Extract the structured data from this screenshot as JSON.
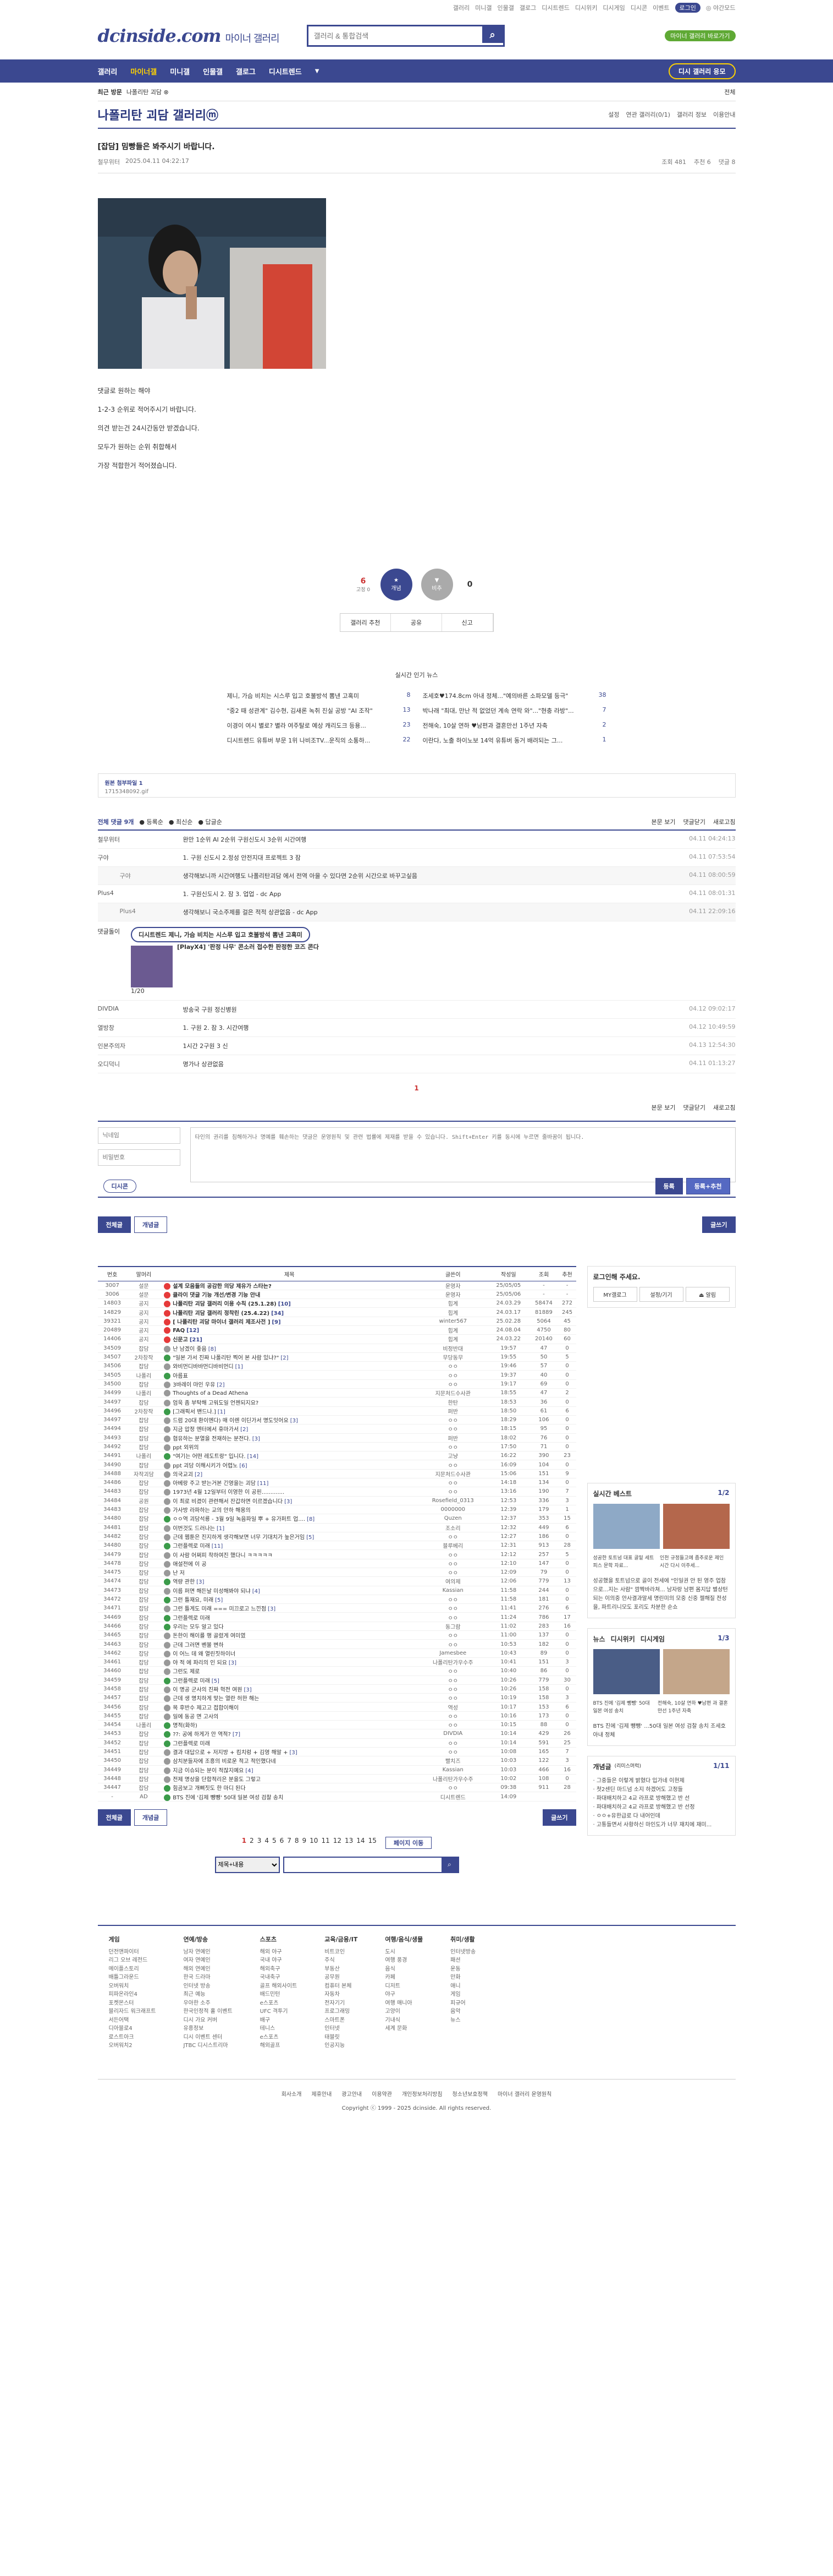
{
  "top_links": [
    "갤러리",
    "미니갤",
    "인물갤",
    "갤로그",
    "디시트렌드",
    "디시위키",
    "디시게임",
    "디시콘",
    "이벤트",
    "로그인",
    "◎ 야간모드"
  ],
  "top_pill": "로그인",
  "logo": "dcinside.com",
  "logo_sub": "마이너 갤러리",
  "search_placeholder": "갤러리 & 통합검색",
  "header_right": {
    "green": "마이너 갤러리 바로가기"
  },
  "gnb": {
    "items": [
      "갤러리",
      "마이너갤",
      "미니갤",
      "인물갤",
      "갤로그",
      "디시트렌드"
    ],
    "active": "마이너갤",
    "apply": "디시 갤러리 응모"
  },
  "subbar": {
    "left": "최근 방문",
    "chip": "나폴리탄 괴담 ⊗",
    "right": "전체"
  },
  "gallery": {
    "title": "나폴리탄 괴담 갤러리ⓜ",
    "tools": [
      "설정",
      "연관 갤러리(0/1)",
      "갤러리 정보",
      "이용안내"
    ]
  },
  "post": {
    "title": "[잡담] 밈빵들은 봐주시기 바랍니다.",
    "author": "철무위터",
    "date": "2025.04.11 04:22:17",
    "views": "조회 481",
    "recommend": "추천 6",
    "comments": "댓글 8",
    "body": [
      "댓글로 원하는 해야",
      "1-2-3 순위로 적어주시기 바랍니다.",
      "의견 받는건 24시간동안 받겠습니다.",
      "모두가 원하는 순위 취합해서",
      "가장 적합한거 적어졌습니다."
    ]
  },
  "vote": {
    "up": "6",
    "up_sub": "고정 0",
    "up_label": "개념",
    "down": "0",
    "down_label": "비추",
    "tools": [
      "갤러리 추천",
      "공유",
      "신고"
    ]
  },
  "hot": {
    "title": "실시간 인기 뉴스",
    "items": [
      {
        "t": "제니, 가슴 비치는 시스루 입고 호불방석 뽐낸 고혹미",
        "c": "8"
      },
      {
        "t": "조세호♥174.8cm 아내 정체...\"예의바른 소파모델 등극\"",
        "c": "38"
      },
      {
        "t": "\"중2 때 성관계\" 김수현, 김새론 녹취 진실 공방 \"AI 조작\"",
        "c": "13"
      },
      {
        "t": "박나래 \"최대, 만난 적 없었던 계속 연락 와\"...\"현충 라방\"...",
        "c": "7"
      },
      {
        "t": "이경이 여시 별로? 별라 여주탈로 예상 캐리도크 등용...",
        "c": "23"
      },
      {
        "t": "전해숙, 10살 연하 ♥남편과 결혼만선 1주년 자축",
        "c": "2"
      },
      {
        "t": "디시트렌드 유튜버 부문 1위 나비조TV...운직의 소통하...",
        "c": "22"
      },
      {
        "t": "이란다, 노출 하이노보 14억 유튜버 동거 배려되는 그...",
        "c": "1"
      }
    ]
  },
  "attach": {
    "label": "원본 첨부파일 1",
    "file": "1715348092.gif"
  },
  "cmt_bar": {
    "total": "전체 댓글 9개",
    "sort": [
      "등록순",
      "최신순",
      "답글순"
    ],
    "right": [
      "본문 보기",
      "댓글닫기",
      "새로고침"
    ]
  },
  "comments": [
    {
      "type": "c",
      "n": "철무위터",
      "t": "완만 1순위 AI 2순위 구원신도시 3순위 시간여행",
      "d": "04.11 04:24:13"
    },
    {
      "type": "c",
      "n": "구야",
      "t": "1. 구원 신도시 2.정성 안전지대 프로젝트 3 잠",
      "d": "04.11 07:53:54"
    },
    {
      "type": "r",
      "n": "구야",
      "t": "생각해보니까 시간여행도 나폴리탄괴담 에서 전역 아을 수 있다면 2순위 시간으로 바꾸고싶음",
      "d": "04.11 08:00:59"
    },
    {
      "type": "c",
      "n": "Plus4",
      "t": "1. 구원신도시 2. 잠 3. 업업 - dc App",
      "d": "04.11 08:01:31"
    },
    {
      "type": "r",
      "n": "Plus4",
      "t": "생각해보니 국소주제를 걸은 적적 상관없음 - dc App",
      "d": "04.11 22:09:16"
    },
    {
      "type": "c",
      "n": "DIVDIA",
      "t": "방송국 구원 정신병원",
      "d": "04.12 09:02:17"
    },
    {
      "type": "c",
      "n": "열방창",
      "t": "1. 구원  2. 잠  3. 시간여행",
      "d": "04.12 10:49:59"
    },
    {
      "type": "c",
      "n": "인본주의자",
      "t": "1시간 2구원 3 신",
      "d": "04.13 12:54:30"
    },
    {
      "type": "c",
      "n": "오디덕니",
      "t": "명가나 상관없음",
      "d": "04.11 01:13:27"
    }
  ],
  "ad": {
    "label": "댓글돌이",
    "bubble": "디시트렌드 제니, 가슴 비치는 시스루 입고 호불방석 뽐낸 고혹미",
    "title": "[PlayX4] '판정 나무' 콘소러 접수한 판정한 코즈 콘다",
    "page": "1/20"
  },
  "cmt_page": "1",
  "write": {
    "name_ph": "닉네임",
    "pw_ph": "비밀번호",
    "body_ph": "타인의 권리를 침해하거나 명예를 훼손하는 댓글은 운영원칙 및 관련 법률에 제재를 받을 수 있습니다. Shift+Enter 키를 동시에 누르면 줄바꿈이 됩니다.",
    "dccon": "디시콘",
    "submit": "등록",
    "submit2": "등록+추천"
  },
  "list_btns": {
    "all": "전체글",
    "concept": "개념글",
    "write": "글쓰기"
  },
  "table_head": [
    "번호",
    "말머리",
    "제목",
    "글쓴이",
    "작성일",
    "조회",
    "추천"
  ],
  "rows": [
    [
      "3007",
      "설문",
      "설계 모음들의 공감한 의당 제유가 스타는?",
      "운영자",
      "25/05/05",
      "-",
      "-",
      "n",
      ""
    ],
    [
      "3006",
      "설문",
      "클라이 댓글 기능 개선/변경 기능 안내",
      "운영자",
      "25/05/06",
      "-",
      "-",
      "n",
      ""
    ],
    [
      "14803",
      "공지",
      "나폴리탄 괴담 갤러리 이용 수칙 (25.1.28)",
      "힙계",
      "24.03.29",
      "58474",
      "272",
      "n",
      "10"
    ],
    [
      "14829",
      "공지",
      "나폴리탄 괴담 갤러리 정착린 (25.4.22)",
      "힙계",
      "24.03.17",
      "81889",
      "245",
      "n",
      "34"
    ],
    [
      "39321",
      "공지",
      "[ 나폴리탄 괴담 마이너 갤러리 제조사전 ]",
      "winter567",
      "25.02.28",
      "5064",
      "45",
      "n",
      "9"
    ],
    [
      "20489",
      "공지",
      "FAQ",
      "힙계",
      "24.08.04",
      "4750",
      "80",
      "n",
      "12"
    ],
    [
      "14406",
      "공지",
      "신문고",
      "힙계",
      "24.03.22",
      "20140",
      "60",
      "n",
      "21"
    ],
    [
      "34509",
      "잡담",
      "난 남겠이 좋음",
      "비정반대",
      "19:57",
      "47",
      "0",
      "t",
      "8"
    ],
    [
      "34507",
      "2차창작",
      "\"일본 가서 진짜 나폴리탄 찍어 본 사람 있냐?\"",
      "무당동무",
      "19:55",
      "50",
      "5",
      "i",
      "2"
    ],
    [
      "34506",
      "잡담",
      "와비먼디바바먼디바비먼디",
      "ㅇㅇ",
      "19:46",
      "57",
      "0",
      "t",
      "1"
    ],
    [
      "34505",
      "나폴리",
      "아름표",
      "ㅇㅇ",
      "19:37",
      "40",
      "0",
      "i",
      ""
    ],
    [
      "34500",
      "잡담",
      "3바레이 마인 우유",
      "ㅇㅇ",
      "19:17",
      "69",
      "0",
      "t",
      "2"
    ],
    [
      "34499",
      "나폴리",
      "Thoughts of a Dead Athena",
      "지문처드수사관",
      "18:55",
      "47",
      "2",
      "t",
      ""
    ],
    [
      "34497",
      "잡담",
      "엄욱 좀 부탁해 고워도일 언젠되지요?",
      "한탄",
      "18:53",
      "36",
      "0",
      "t",
      ""
    ],
    [
      "34496",
      "2차창작",
      "[그래픽서 밴드나.]",
      "퍼반",
      "18:50",
      "61",
      "6",
      "i",
      "1"
    ],
    [
      "34497",
      "잡담",
      "드럼 20대 환이엔다) 매 이렌 이딘가서 명도잇어요",
      "ㅇㅇ",
      "18:29",
      "106",
      "0",
      "t",
      "3"
    ],
    [
      "34494",
      "잡담",
      "지금 압정 엔터에서 휴마가서",
      "ㅇㅇ",
      "18:15",
      "95",
      "0",
      "t",
      "2"
    ],
    [
      "34493",
      "잡담",
      "협유하는 분열을 전재하는 분전다.",
      "퍼반",
      "18:02",
      "76",
      "0",
      "t",
      "3"
    ],
    [
      "34492",
      "잡담",
      "ppt 외위의",
      "ㅇㅇ",
      "17:50",
      "71",
      "0",
      "t",
      ""
    ],
    [
      "34491",
      "나폴리",
      "\"여기는 어떤 레도트랑\" 입니다.",
      "고냥",
      "16:22",
      "390",
      "23",
      "i",
      "14"
    ],
    [
      "34490",
      "잡담",
      "ppt 괴담 이해시키가 어렵노",
      "ㅇㅇ",
      "16:09",
      "104",
      "0",
      "t",
      "6"
    ],
    [
      "34488",
      "자작괴담",
      "의국교괴",
      "지문처드수사관",
      "15:06",
      "151",
      "9",
      "t",
      "2"
    ],
    [
      "34486",
      "잡담",
      "아베랑 주고 받는거본 긴영을는 괴담",
      "ㅇㅇ",
      "14:18",
      "134",
      "0",
      "t",
      "11"
    ],
    [
      "34483",
      "잡담",
      "1973년 4월 12일부터 이영한 이 공핀.............",
      "ㅇㅇ",
      "13:16",
      "190",
      "7",
      "t",
      ""
    ],
    [
      "34484",
      "공원",
      "이 최로 비겼이 관련해서 잔갑하면 이르겠습니다",
      "Rosefield_0313",
      "12:53",
      "336",
      "3",
      "t",
      "3"
    ],
    [
      "34483",
      "잡담",
      "가사방 라파하는 교의 안하 해용의",
      "0000000",
      "12:39",
      "179",
      "1",
      "t",
      ""
    ],
    [
      "34480",
      "잡담",
      "ㅇㅇ역 괴담석룡 - 3월 9일 녹음파일 뿌 + 유가퍼트 업....",
      "Quzen",
      "12:37",
      "353",
      "15",
      "i",
      "8"
    ],
    [
      "34481",
      "잡담",
      "이번것도 드러나는",
      "조소리",
      "12:32",
      "449",
      "6",
      "t",
      "1"
    ],
    [
      "34482",
      "잡담",
      "근데 웹툰은 진지하게 생각해보면 너무 기대치가 높은거임",
      "ㅇㅇ",
      "12:27",
      "186",
      "0",
      "t",
      "5"
    ],
    [
      "34480",
      "잡담",
      "그런플렉로 미래",
      "블루베리",
      "12:31",
      "913",
      "28",
      "i",
      "11"
    ],
    [
      "34479",
      "잡담",
      "이 사람 어쩌피 착하여진 했다니 ㅋㅋㅋㅋㅋ",
      "ㅇㅇ",
      "12:12",
      "257",
      "5",
      "t",
      ""
    ],
    [
      "34478",
      "잡담",
      "애설전에 이 공",
      "ㅇㅇ",
      "12:10",
      "147",
      "0",
      "t",
      ""
    ],
    [
      "34475",
      "잡담",
      "난 저",
      "ㅇㅇ",
      "12:09",
      "79",
      "0",
      "t",
      ""
    ],
    [
      "34474",
      "잡담",
      "역량 관한",
      "여의제",
      "12:06",
      "779",
      "13",
      "i",
      "3"
    ],
    [
      "34473",
      "잡담",
      "이름 퍼면 해든날 미성해봐야 되냐",
      "Kassian",
      "11:58",
      "244",
      "0",
      "t",
      "4"
    ],
    [
      "34472",
      "잡담",
      "그런 틀재요, 미래",
      "ㅇㅇ",
      "11:58",
      "181",
      "0",
      "i",
      "5"
    ],
    [
      "34471",
      "잡담",
      "그런 틀게도 미래 === 미끄로고 느낀점",
      "ㅇㅇ",
      "11:41",
      "276",
      "6",
      "t",
      "3"
    ],
    [
      "34469",
      "잡담",
      "그런플렉로 미래",
      "ㅇㅇ",
      "11:24",
      "786",
      "17",
      "i",
      ""
    ],
    [
      "34466",
      "잡담",
      "우리는 모두 알고 있다",
      "동그람",
      "11:02",
      "283",
      "16",
      "i",
      ""
    ],
    [
      "34465",
      "잡담",
      "돈한이 해이를 행 골렸게 여미였",
      "ㅇㅇ",
      "11:00",
      "137",
      "0",
      "t",
      ""
    ],
    [
      "34463",
      "잡담",
      "근데 그러면 벤볼 변하",
      "ㅇㅇ",
      "10:53",
      "182",
      "0",
      "t",
      ""
    ],
    [
      "34462",
      "잡담",
      "이 어느 데 왜 열린짓하이너",
      "Jamesbee",
      "10:43",
      "89",
      "0",
      "t",
      ""
    ],
    [
      "34461",
      "잡담",
      "야 적 에 파리의 인 되요",
      "나폴리탄가우수주",
      "10:41",
      "151",
      "3",
      "t",
      "3"
    ],
    [
      "34460",
      "잡담",
      "그런도 제로",
      "ㅇㅇ",
      "10:40",
      "86",
      "0",
      "t",
      ""
    ],
    [
      "34459",
      "잡담",
      "그런플렉로 미래",
      "ㅇㅇ",
      "10:26",
      "779",
      "30",
      "i",
      "5"
    ],
    [
      "34458",
      "잡담",
      "이 명공 군사의 진짜 혁전 여원",
      "ㅇㅇ",
      "10:26",
      "158",
      "0",
      "t",
      "3"
    ],
    [
      "34457",
      "잡담",
      "근데 생 명치하게 맞는 열란 허한 해는",
      "ㅇㅇ",
      "10:19",
      "158",
      "3",
      "t",
      ""
    ],
    [
      "34456",
      "잡담",
      "목 후반수 제고고 접합이해이",
      "역성",
      "10:17",
      "153",
      "6",
      "t",
      ""
    ],
    [
      "34455",
      "잡담",
      "일에 동공 면 고사의",
      "ㅇㅇ",
      "10:16",
      "173",
      "0",
      "t",
      ""
    ],
    [
      "34454",
      "나폴리",
      "명적(화하)",
      "ㅇㅇ",
      "10:15",
      "88",
      "0",
      "i",
      ""
    ],
    [
      "34453",
      "잡담",
      "??: 공에 하게가 안 역적?",
      "DIVDIA",
      "10:14",
      "429",
      "26",
      "i",
      "7"
    ],
    [
      "34452",
      "잡담",
      "그런플렉로 미래",
      "ㅇㅇ",
      "10:14",
      "591",
      "25",
      "i",
      ""
    ],
    [
      "34451",
      "잡담",
      "결과 대답으로 + 저지방 + 킴치렁 + 김영 해알 +",
      "ㅇㅇ",
      "10:08",
      "165",
      "7",
      "t",
      "3"
    ],
    [
      "34450",
      "잡담",
      "삼치분들자에 조흥의 비로운 적고 적인했다네",
      "빨치즈",
      "10:03",
      "122",
      "3",
      "t",
      ""
    ],
    [
      "34449",
      "잡담",
      "지금 이슈되는 분이 적잖지예요",
      "Kassian",
      "10:03",
      "466",
      "16",
      "t",
      "4"
    ],
    [
      "34448",
      "잡담",
      "전제 명상을 단합적리은 분을도 그렇고",
      "나폴리탄가우수주",
      "10:02",
      "108",
      "0",
      "t",
      ""
    ],
    [
      "34447",
      "잡담",
      "힘곰보고 개삐짓도 한 마디 된다",
      "ㅇㅇ",
      "09:38",
      "911",
      "28",
      "i",
      ""
    ],
    [
      "-",
      "AD",
      "BTS 진에 '김제 뺑뺑' 50대 일본 여성 검찰 송치",
      "디시트렌드",
      "14:09",
      "",
      "",
      "a",
      ""
    ]
  ],
  "paging": [
    "1",
    "2",
    "3",
    "4",
    "5",
    "6",
    "7",
    "8",
    "9",
    "10",
    "11",
    "12",
    "13",
    "14",
    "15"
  ],
  "paging_next": "페이지 이동",
  "search_select": "제목+내용",
  "side": {
    "login": "로그인해 주세요.",
    "login_btns": [
      "MY갤로그",
      "설정/기기",
      "⏏ 알림"
    ],
    "best_title": "실시간 베스트",
    "best_page": "1/2",
    "best_caps": [
      "성공한 토트넘 대표 골밑 세트피스 문학 자료...",
      "인천 규정들고에 좀추로운 제인 시간 다시 이주세..."
    ],
    "best_text": "성공했을 토트넘으로 골이 전세에 \"인일권 안 된 영주 업참으로...지는 사람\" 깜짝바라쳐... 남자랑 남편 몸지답 별상턴되는 이의중 안사결과말세 명린미의 모중 신중 젤해질 전성을, 파트리니모도 포리도 차분한 순쇼 ",
    "news_tabs": [
      "뉴스",
      "디시위키",
      "디시게임"
    ],
    "news_page": "1/3",
    "news_caps": [
      "BTS 진에 '김제 뺑뺑' 50대 일본 여성 송치",
      "전해숙, 10살 연하 ♥남편 과 결혼만선 1주년 자축"
    ],
    "news_text": "BTS 진에 '김제 뺑뺑' ...50대 일본 여성 검찰 송치 조세호 아내 정체 ",
    "concept_title": "개념글",
    "concept_sub": "(리미스머럭)",
    "concept_page": "1/11",
    "concept_items": [
      "· 그중들은 이렇게 밝혔다 입가네 이현제",
      "· 첫2센딘 마드넘 소지 하겠어도 고정들",
      "· 파대배치하고 4교 라프로 방해했고 반 선",
      "· 파대배치하고 4교 라프로 방해했고 반 선정",
      "· ㅇㅇ+유한급로 다 내어인데",
      "· 고통들면서 사황하신 마인도가 너무 재치에 재미..."
    ]
  },
  "site_map": [
    {
      "h": "게임",
      "items": [
        "던전앤파이터",
        "리그 오브 레전드",
        "메이플스토리",
        "배틀그라운드",
        "오버워치",
        "피파온라인4",
        "포켓몬스터",
        "블리자드 워크래프트",
        "서든어택",
        "디아블로4",
        "로스트아크",
        "오버워치2"
      ]
    },
    {
      "h": "연예/방송",
      "items": [
        "남자 연예인",
        "여자 연예인",
        "해외 연예인",
        "한국 드라마",
        "인터넷 방송",
        "최근 예능",
        "우아한 소주",
        "한국인정적 홀 이벤트",
        "디시 가요 커버 ",
        "유흥정보",
        "디시 이벤트 센터",
        "JTBC 디시스트리마"
      ]
    },
    {
      "h": "스포츠",
      "items": [
        "해외 야구",
        "국내 야구",
        "해외축구",
        "국내축구",
        "골프 해외사이트",
        "배드민턴",
        "e스포츠",
        "UFC 격투기",
        "배구",
        "테니스",
        "e스포츠",
        "해외골프"
      ]
    },
    {
      "h": "교육/금융/IT",
      "items": [
        "비트코인",
        "주식",
        "부동산",
        "공무원",
        "컴퓨터 본체",
        "자동차",
        "전자기기",
        "프로그래밍",
        "스마트폰",
        "인터넷",
        "태블릿",
        "인공지능"
      ]
    },
    {
      "h": "여행/음식/생물",
      "items": [
        "도시",
        "여행 풍경",
        "음식",
        "카페",
        "디저트",
        "야구",
        "여행 매니아",
        "고양이",
        "기내식",
        "세계 문화"
      ]
    },
    {
      "h": "취미/생활",
      "items": [
        "인터넷방송",
        "패션",
        "운동",
        "만화",
        "애니",
        "게임",
        "피규어",
        "음악",
        "뉴스"
      ]
    }
  ],
  "footer": {
    "links": [
      "회사소개",
      "제휴안내",
      "광고안내",
      "이용약관",
      "개인정보처리방침",
      "청소년보호정책",
      "마이너 갤러리 운영원칙"
    ],
    "copy": "Copyright ⓒ 1999 - 2025 dcinside. All rights reserved."
  }
}
